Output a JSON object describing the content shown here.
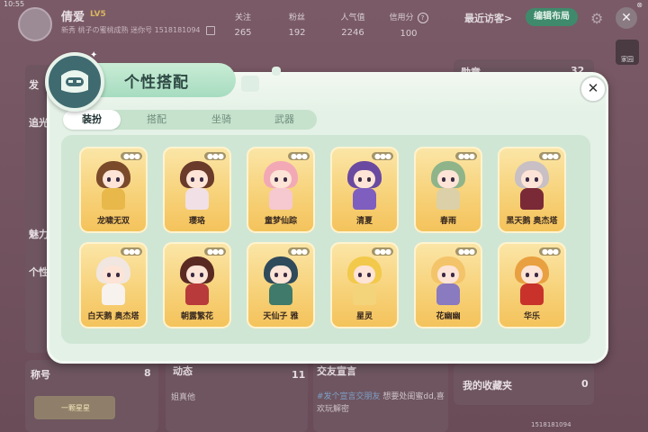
{
  "status": {
    "time": "10:55",
    "battery": "⊗"
  },
  "profile": {
    "name": "倩爱",
    "level": "LV5",
    "subline": "新秀  桃子の蜜桃成熟  迷你号 1518181094",
    "stats": [
      {
        "label": "关注",
        "value": "265"
      },
      {
        "label": "粉丝",
        "value": "192"
      },
      {
        "label": "人气值",
        "value": "2246"
      },
      {
        "label": "信用分",
        "value": "100"
      }
    ],
    "recent_visitors": "最近访客>",
    "edit_layout": "编辑布局"
  },
  "background_panels": {
    "medal_label": "勋章",
    "medal_count": "32",
    "title_label": "称号",
    "title_count": "8",
    "title_badge_text": "一颗星星",
    "dynamics_label": "动态",
    "dynamics_count": "11",
    "dynamics_text": "姐真他",
    "declaration_label": "交友宣言",
    "declaration_tag": "#发个宣言交朋友",
    "declaration_text": "想要处闺蜜dd,喜欢玩解密",
    "favorites_label": "我的收藏夹",
    "favorites_count": "0",
    "home_label": "家园",
    "left_fragments": [
      "发",
      "追光",
      "魅力",
      "个性"
    ],
    "footer_id": "1518181094"
  },
  "modal": {
    "title": "个性搭配",
    "tabs": [
      {
        "label": "装扮",
        "active": true
      },
      {
        "label": "搭配",
        "active": false
      },
      {
        "label": "坐骑",
        "active": false
      },
      {
        "label": "武器",
        "active": false
      }
    ],
    "more_glyph": "●●●",
    "skins": [
      {
        "name": "龙啸无双",
        "hair": "#7a4a2a",
        "body": "#e8b84a"
      },
      {
        "name": "璎珞",
        "hair": "#6a3a2a",
        "body": "#f1e0e6"
      },
      {
        "name": "童梦仙踪",
        "hair": "#f2a9b5",
        "body": "#f6c8d0"
      },
      {
        "name": "清夏",
        "hair": "#6a4aa0",
        "body": "#7e5fbf"
      },
      {
        "name": "春雨",
        "hair": "#8fb48a",
        "body": "#dcd0a8"
      },
      {
        "name": "黑天鹅 奥杰塔",
        "hair": "#c8c0c4",
        "body": "#7a2a36"
      },
      {
        "name": "白天鹅 奥杰塔",
        "hair": "#f1e6e0",
        "body": "#f8f2ee"
      },
      {
        "name": "朝露繁花",
        "hair": "#5a2a22",
        "body": "#b83a3a"
      },
      {
        "name": "天仙子 雅",
        "hair": "#2f4a5a",
        "body": "#3f7a6a"
      },
      {
        "name": "星灵",
        "hair": "#f2c94a",
        "body": "#f4d47a"
      },
      {
        "name": "花幽幽",
        "hair": "#f4c46a",
        "body": "#8a7ac0"
      },
      {
        "name": "华乐",
        "hair": "#e8a040",
        "body": "#c8322a"
      }
    ]
  },
  "colors": {
    "accent": "#3f8a6c",
    "modal_bg": "#e4f1e6",
    "card_gold": "#f7d27a"
  }
}
